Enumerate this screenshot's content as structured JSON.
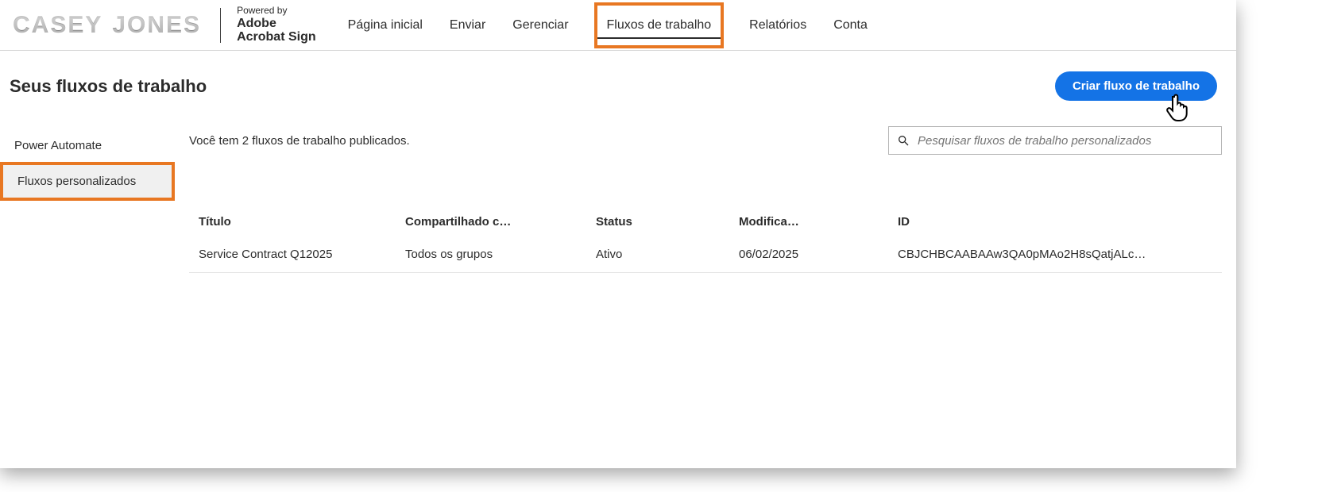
{
  "brand": {
    "word1": "CASEY",
    "word2": "JONES"
  },
  "powered": {
    "line1": "Powered by",
    "line2": "Adobe",
    "line3": "Acrobat Sign"
  },
  "nav": {
    "home": "Página inicial",
    "send": "Enviar",
    "manage": "Gerenciar",
    "workflows": "Fluxos de trabalho",
    "reports": "Relatórios",
    "account": "Conta"
  },
  "page_title": "Seus fluxos de trabalho",
  "cta_label": "Criar fluxo de trabalho",
  "sidebar": {
    "power_automate": "Power Automate",
    "custom_flows": "Fluxos personalizados"
  },
  "count_text": "Você tem 2 fluxos de trabalho publicados.",
  "search_placeholder": "Pesquisar fluxos de trabalho personalizados",
  "table": {
    "headers": {
      "title": "Título",
      "shared": "Compartilhado c…",
      "status": "Status",
      "modified": "Modifica…",
      "id": "ID"
    },
    "row": {
      "title": "Service Contract Q12025",
      "shared": "Todos os grupos",
      "status": "Ativo",
      "modified": "06/02/2025",
      "id": "CBJCHBCAABAAw3QA0pMAo2H8sQatjALc…"
    }
  }
}
